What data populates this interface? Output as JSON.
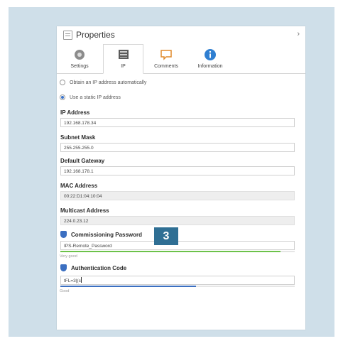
{
  "window": {
    "title": "Properties",
    "chevron": "›"
  },
  "tabs": [
    {
      "label": "Settings",
      "icon": "gear-icon"
    },
    {
      "label": "IP",
      "icon": "network-card-icon"
    },
    {
      "label": "Comments",
      "icon": "comment-icon"
    },
    {
      "label": "Information",
      "icon": "info-icon"
    }
  ],
  "ip_mode": {
    "option_auto": "Obtain an IP address automatically",
    "option_static": "Use a static IP address",
    "selected": "static"
  },
  "fields": {
    "ip_address": {
      "label": "IP Address",
      "value": "192.168.178.34"
    },
    "subnet_mask": {
      "label": "Subnet Mask",
      "value": "255.255.255.0"
    },
    "default_gateway": {
      "label": "Default Gateway",
      "value": "192.168.178.1"
    },
    "mac_address": {
      "label": "MAC Address",
      "value": "00:22:D1:04:10:04"
    },
    "multicast_address": {
      "label": "Multicast Address",
      "value": "224.0.23.12"
    },
    "commissioning_password": {
      "label": "Commissioning Password",
      "value": "IPS-Remote_Password",
      "strength_text": "Very good",
      "strength": 0.94
    },
    "authentication_code": {
      "label": "Authentication Code",
      "value": "tFL=3|(c",
      "strength_text": "Good",
      "strength": 0.58
    }
  },
  "callout": {
    "number": "3"
  },
  "colors": {
    "background": "#cfdfe9",
    "accent": "#3b6fc1",
    "strength_very_good": "#6cc24a",
    "strength_good": "#3b6fc1",
    "callout": "#2f6f94"
  }
}
